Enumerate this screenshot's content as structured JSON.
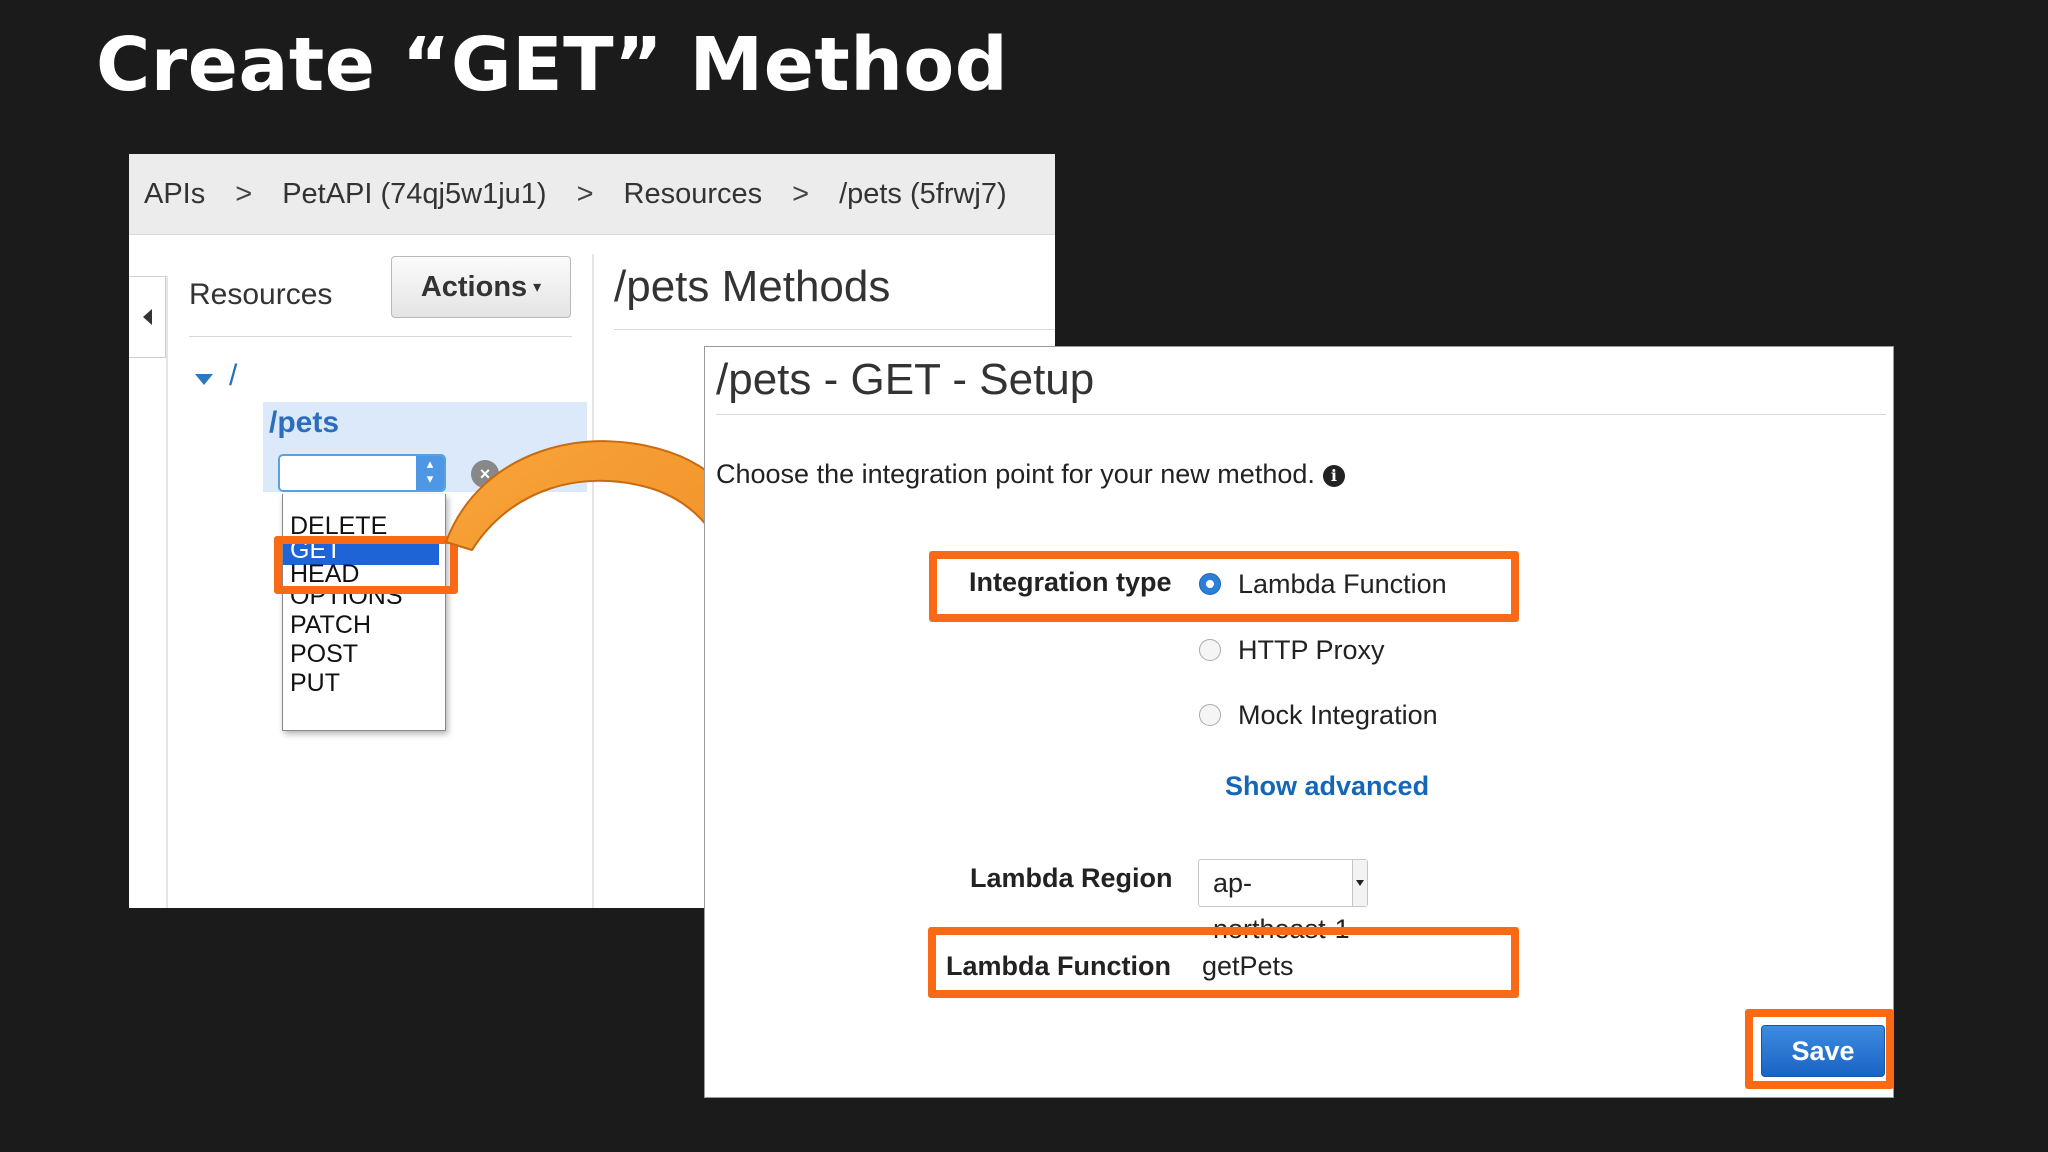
{
  "slide": {
    "title": "Create “GET” Method"
  },
  "breadcrumb": {
    "items": [
      "APIs",
      "PetAPI (74qj5w1ju1)",
      "Resources",
      "/pets (5frwj7)"
    ],
    "separator": ">"
  },
  "resources_panel": {
    "label": "Resources",
    "actions_label": "Actions",
    "root": "/",
    "selected_resource": "/pets",
    "method_options": [
      "DELETE",
      "GET",
      "HEAD",
      "OPTIONS",
      "PATCH",
      "POST",
      "PUT"
    ],
    "selected_method": "GET",
    "methods_heading": "/pets Methods"
  },
  "setup": {
    "title": "/pets - GET - Setup",
    "description": "Choose the integration point for your new method.",
    "integration_type_label": "Integration type",
    "integration_options": [
      "Lambda Function",
      "HTTP Proxy",
      "Mock Integration"
    ],
    "selected_integration": "Lambda Function",
    "show_advanced": "Show advanced",
    "region_label": "Lambda Region",
    "region_value": "ap-northeast-1",
    "function_label": "Lambda Function",
    "function_value": "getPets",
    "save_label": "Save"
  },
  "colors": {
    "highlight": "#fa6a15",
    "arrow": "#f2962a",
    "link": "#1466b8",
    "primary_button": "#1a63c4"
  }
}
